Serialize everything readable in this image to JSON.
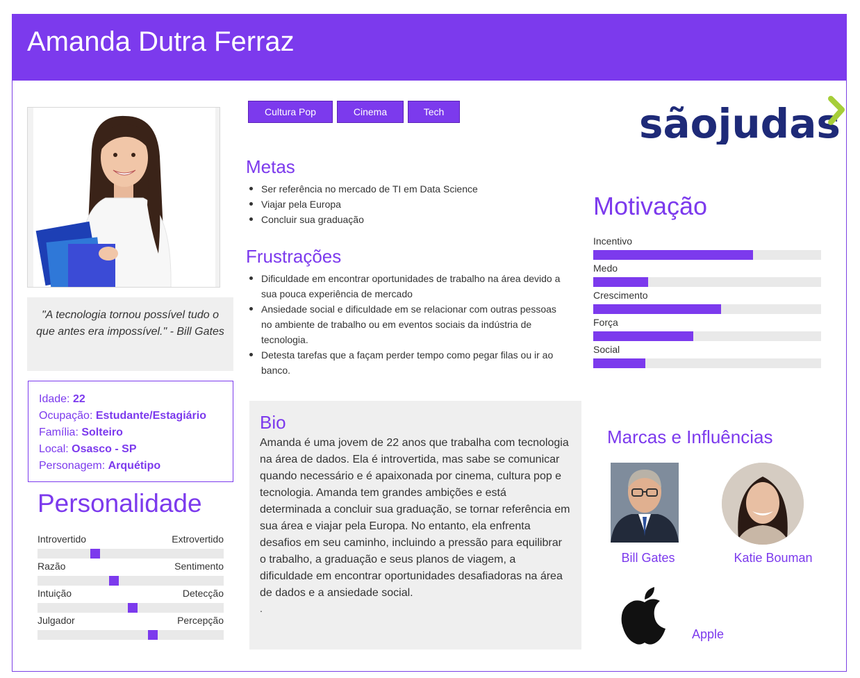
{
  "persona": {
    "name": "Amanda Dutra Ferraz"
  },
  "quote": "\"A tecnologia tornou possível tudo o que antes era impossível.\" - Bill Gates",
  "info": [
    {
      "label": "Idade: ",
      "value": "22"
    },
    {
      "label": "Ocupação: ",
      "value": "Estudante/Estagiário"
    },
    {
      "label": "Família: ",
      "value": "Solteiro"
    },
    {
      "label": "Local: ",
      "value": "Osasco - SP"
    },
    {
      "label": "Personagem: ",
      "value": "Arquétipo"
    }
  ],
  "personality": {
    "title": "Personalidade",
    "scales": [
      {
        "left": "Introvertido",
        "right": "Extrovertido",
        "level": 0.31
      },
      {
        "left": "Razão",
        "right": "Sentimento",
        "level": 0.41
      },
      {
        "left": "Intuição",
        "right": "Detecção",
        "level": 0.51
      },
      {
        "left": "Julgador",
        "right": "Percepção",
        "level": 0.62
      }
    ]
  },
  "tags": [
    "Cultura Pop",
    "Cinema",
    "Tech"
  ],
  "goals": {
    "title": "Metas",
    "items": [
      "Ser referência no mercado de TI em Data Science",
      "Viajar pela Europa",
      "Concluir sua graduação"
    ]
  },
  "frustrations": {
    "title": "Frustrações",
    "items": [
      "Dificuldade em encontrar oportunidades de trabalho na área devido a sua pouca experiência de mercado",
      "Ansiedade social e dificuldade em se relacionar com outras pessoas no ambiente de trabalho ou em eventos sociais da indústria de tecnologia.",
      "Detesta tarefas que a façam perder tempo como pegar filas ou ir ao banco."
    ]
  },
  "bio": {
    "title": "Bio",
    "text": "Amanda é uma jovem de 22 anos que trabalha com tecnologia na área de dados. Ela é introvertida, mas sabe se comunicar quando necessário e é apaixonada por cinema, cultura pop e tecnologia. Amanda tem grandes ambições e está determinada a concluir sua graduação, se tornar referência em sua área e viajar pela Europa. No entanto, ela enfrenta desafios em seu caminho, incluindo a pressão para equilibrar o trabalho, a graduação e seus planos de viagem, a dificuldade em encontrar oportunidades desafiadoras na área de dados e a ansiedade social.",
    "trailing": "."
  },
  "logo": {
    "text": "sãojudas",
    "accent_color": "#a6ce39",
    "text_color": "#1e2a78"
  },
  "motivation": {
    "title": "Motivação",
    "items": [
      {
        "label": "Incentivo",
        "level": 0.7
      },
      {
        "label": "Medo",
        "level": 0.24
      },
      {
        "label": "Crescimento",
        "level": 0.56
      },
      {
        "label": "Força",
        "level": 0.44
      },
      {
        "label": "Social",
        "level": 0.23
      }
    ]
  },
  "brands": {
    "title": "Marcas e Influências",
    "items": [
      {
        "name": "Bill Gates",
        "icon": "person-photo"
      },
      {
        "name": "Katie Bouman",
        "icon": "person-photo"
      },
      {
        "name": "Apple",
        "icon": "apple-logo-icon"
      }
    ]
  },
  "colors": {
    "accent": "#7c3aed",
    "panel": "#efefef",
    "track": "#e9e9e9"
  }
}
